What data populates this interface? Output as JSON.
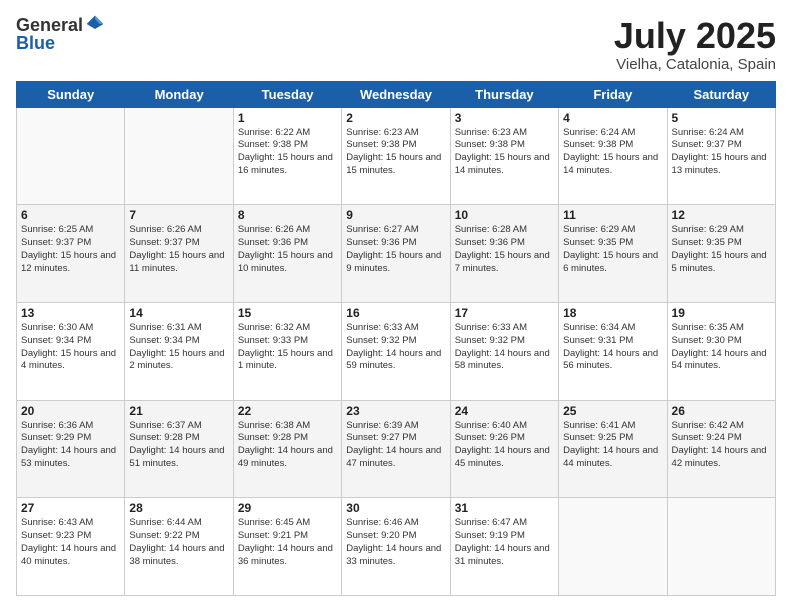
{
  "header": {
    "logo_general": "General",
    "logo_blue": "Blue",
    "month_title": "July 2025",
    "location": "Vielha, Catalonia, Spain"
  },
  "days_of_week": [
    "Sunday",
    "Monday",
    "Tuesday",
    "Wednesday",
    "Thursday",
    "Friday",
    "Saturday"
  ],
  "weeks": [
    [
      {
        "day": "",
        "sunrise": "",
        "sunset": "",
        "daylight": ""
      },
      {
        "day": "",
        "sunrise": "",
        "sunset": "",
        "daylight": ""
      },
      {
        "day": "1",
        "sunrise": "Sunrise: 6:22 AM",
        "sunset": "Sunset: 9:38 PM",
        "daylight": "Daylight: 15 hours and 16 minutes."
      },
      {
        "day": "2",
        "sunrise": "Sunrise: 6:23 AM",
        "sunset": "Sunset: 9:38 PM",
        "daylight": "Daylight: 15 hours and 15 minutes."
      },
      {
        "day": "3",
        "sunrise": "Sunrise: 6:23 AM",
        "sunset": "Sunset: 9:38 PM",
        "daylight": "Daylight: 15 hours and 14 minutes."
      },
      {
        "day": "4",
        "sunrise": "Sunrise: 6:24 AM",
        "sunset": "Sunset: 9:38 PM",
        "daylight": "Daylight: 15 hours and 14 minutes."
      },
      {
        "day": "5",
        "sunrise": "Sunrise: 6:24 AM",
        "sunset": "Sunset: 9:37 PM",
        "daylight": "Daylight: 15 hours and 13 minutes."
      }
    ],
    [
      {
        "day": "6",
        "sunrise": "Sunrise: 6:25 AM",
        "sunset": "Sunset: 9:37 PM",
        "daylight": "Daylight: 15 hours and 12 minutes."
      },
      {
        "day": "7",
        "sunrise": "Sunrise: 6:26 AM",
        "sunset": "Sunset: 9:37 PM",
        "daylight": "Daylight: 15 hours and 11 minutes."
      },
      {
        "day": "8",
        "sunrise": "Sunrise: 6:26 AM",
        "sunset": "Sunset: 9:36 PM",
        "daylight": "Daylight: 15 hours and 10 minutes."
      },
      {
        "day": "9",
        "sunrise": "Sunrise: 6:27 AM",
        "sunset": "Sunset: 9:36 PM",
        "daylight": "Daylight: 15 hours and 9 minutes."
      },
      {
        "day": "10",
        "sunrise": "Sunrise: 6:28 AM",
        "sunset": "Sunset: 9:36 PM",
        "daylight": "Daylight: 15 hours and 7 minutes."
      },
      {
        "day": "11",
        "sunrise": "Sunrise: 6:29 AM",
        "sunset": "Sunset: 9:35 PM",
        "daylight": "Daylight: 15 hours and 6 minutes."
      },
      {
        "day": "12",
        "sunrise": "Sunrise: 6:29 AM",
        "sunset": "Sunset: 9:35 PM",
        "daylight": "Daylight: 15 hours and 5 minutes."
      }
    ],
    [
      {
        "day": "13",
        "sunrise": "Sunrise: 6:30 AM",
        "sunset": "Sunset: 9:34 PM",
        "daylight": "Daylight: 15 hours and 4 minutes."
      },
      {
        "day": "14",
        "sunrise": "Sunrise: 6:31 AM",
        "sunset": "Sunset: 9:34 PM",
        "daylight": "Daylight: 15 hours and 2 minutes."
      },
      {
        "day": "15",
        "sunrise": "Sunrise: 6:32 AM",
        "sunset": "Sunset: 9:33 PM",
        "daylight": "Daylight: 15 hours and 1 minute."
      },
      {
        "day": "16",
        "sunrise": "Sunrise: 6:33 AM",
        "sunset": "Sunset: 9:32 PM",
        "daylight": "Daylight: 14 hours and 59 minutes."
      },
      {
        "day": "17",
        "sunrise": "Sunrise: 6:33 AM",
        "sunset": "Sunset: 9:32 PM",
        "daylight": "Daylight: 14 hours and 58 minutes."
      },
      {
        "day": "18",
        "sunrise": "Sunrise: 6:34 AM",
        "sunset": "Sunset: 9:31 PM",
        "daylight": "Daylight: 14 hours and 56 minutes."
      },
      {
        "day": "19",
        "sunrise": "Sunrise: 6:35 AM",
        "sunset": "Sunset: 9:30 PM",
        "daylight": "Daylight: 14 hours and 54 minutes."
      }
    ],
    [
      {
        "day": "20",
        "sunrise": "Sunrise: 6:36 AM",
        "sunset": "Sunset: 9:29 PM",
        "daylight": "Daylight: 14 hours and 53 minutes."
      },
      {
        "day": "21",
        "sunrise": "Sunrise: 6:37 AM",
        "sunset": "Sunset: 9:28 PM",
        "daylight": "Daylight: 14 hours and 51 minutes."
      },
      {
        "day": "22",
        "sunrise": "Sunrise: 6:38 AM",
        "sunset": "Sunset: 9:28 PM",
        "daylight": "Daylight: 14 hours and 49 minutes."
      },
      {
        "day": "23",
        "sunrise": "Sunrise: 6:39 AM",
        "sunset": "Sunset: 9:27 PM",
        "daylight": "Daylight: 14 hours and 47 minutes."
      },
      {
        "day": "24",
        "sunrise": "Sunrise: 6:40 AM",
        "sunset": "Sunset: 9:26 PM",
        "daylight": "Daylight: 14 hours and 45 minutes."
      },
      {
        "day": "25",
        "sunrise": "Sunrise: 6:41 AM",
        "sunset": "Sunset: 9:25 PM",
        "daylight": "Daylight: 14 hours and 44 minutes."
      },
      {
        "day": "26",
        "sunrise": "Sunrise: 6:42 AM",
        "sunset": "Sunset: 9:24 PM",
        "daylight": "Daylight: 14 hours and 42 minutes."
      }
    ],
    [
      {
        "day": "27",
        "sunrise": "Sunrise: 6:43 AM",
        "sunset": "Sunset: 9:23 PM",
        "daylight": "Daylight: 14 hours and 40 minutes."
      },
      {
        "day": "28",
        "sunrise": "Sunrise: 6:44 AM",
        "sunset": "Sunset: 9:22 PM",
        "daylight": "Daylight: 14 hours and 38 minutes."
      },
      {
        "day": "29",
        "sunrise": "Sunrise: 6:45 AM",
        "sunset": "Sunset: 9:21 PM",
        "daylight": "Daylight: 14 hours and 36 minutes."
      },
      {
        "day": "30",
        "sunrise": "Sunrise: 6:46 AM",
        "sunset": "Sunset: 9:20 PM",
        "daylight": "Daylight: 14 hours and 33 minutes."
      },
      {
        "day": "31",
        "sunrise": "Sunrise: 6:47 AM",
        "sunset": "Sunset: 9:19 PM",
        "daylight": "Daylight: 14 hours and 31 minutes."
      },
      {
        "day": "",
        "sunrise": "",
        "sunset": "",
        "daylight": ""
      },
      {
        "day": "",
        "sunrise": "",
        "sunset": "",
        "daylight": ""
      }
    ]
  ]
}
